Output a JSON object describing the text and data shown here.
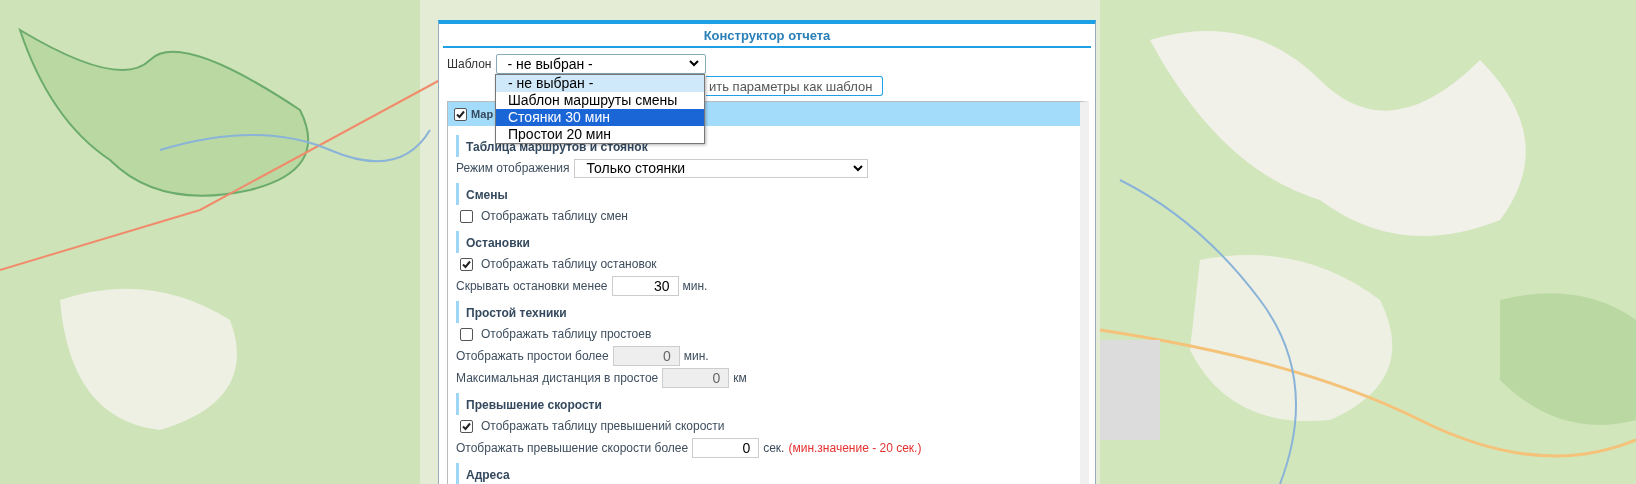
{
  "dialog": {
    "title": "Конструктор отчета"
  },
  "template": {
    "label": "Шаблон",
    "value": "- не выбран -"
  },
  "template_options": [
    {
      "label": "- не выбран -",
      "selected": false,
      "current": true
    },
    {
      "label": "Шаблон маршруты смены",
      "selected": false,
      "current": false
    },
    {
      "label": "Стоянки 30 мин",
      "selected": true,
      "current": false
    },
    {
      "label": "Простои 20 мин",
      "selected": false,
      "current": false
    }
  ],
  "save_button": {
    "label": "ить параметры как шаблон"
  },
  "group": {
    "label": "Мар",
    "checked": true
  },
  "sections": [
    {
      "heading": "Таблица маршрутов и стоянок",
      "rows": [
        {
          "kind": "select",
          "label": "Режим отображения",
          "value": "Только стоянки"
        }
      ]
    },
    {
      "heading": "Смены",
      "rows": [
        {
          "kind": "checkbox",
          "label": "Отображать таблицу смен",
          "checked": false
        }
      ]
    },
    {
      "heading": "Остановки",
      "rows": [
        {
          "kind": "checkbox",
          "label": "Отображать таблицу остановок",
          "checked": true
        },
        {
          "kind": "number",
          "label": "Скрывать остановки менее",
          "value": "30",
          "unit": "мин.",
          "disabled": false
        }
      ]
    },
    {
      "heading": "Простой техники",
      "rows": [
        {
          "kind": "checkbox",
          "label": "Отображать таблицу простоев",
          "checked": false
        },
        {
          "kind": "number",
          "label": "Отображать простои более",
          "value": "0",
          "unit": "мин.",
          "disabled": true
        },
        {
          "kind": "number",
          "label": "Максимальная дистанция в простое",
          "value": "0",
          "unit": "км",
          "disabled": true
        }
      ]
    },
    {
      "heading": "Превышение скорости",
      "rows": [
        {
          "kind": "checkbox",
          "label": "Отображать таблицу превышений скорости",
          "checked": true
        },
        {
          "kind": "number",
          "label": "Отображать превышение скорости более",
          "value": "0",
          "unit": "сек.",
          "disabled": false,
          "note": "(мин.значение - 20 сек.)"
        }
      ]
    },
    {
      "heading": "Адреса"
    }
  ]
}
